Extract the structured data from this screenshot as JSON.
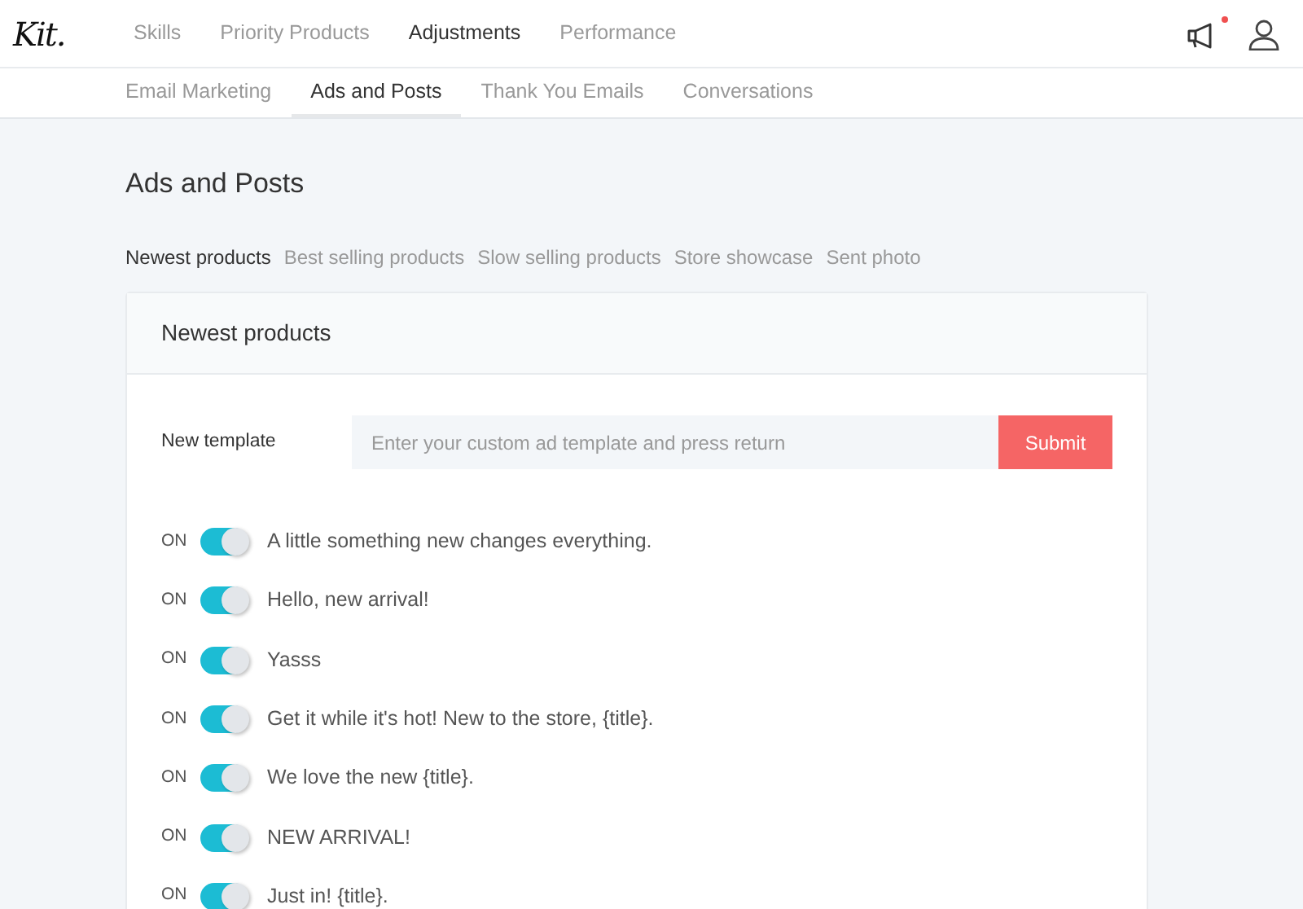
{
  "logo": "Kit.",
  "main_nav": [
    {
      "label": "Skills",
      "selected": false
    },
    {
      "label": "Priority Products",
      "selected": false
    },
    {
      "label": "Adjustments",
      "selected": true
    },
    {
      "label": "Performance",
      "selected": false
    }
  ],
  "notifications": {
    "unread": true
  },
  "sub_nav": [
    {
      "label": "Email Marketing",
      "selected": false
    },
    {
      "label": "Ads and Posts",
      "selected": true
    },
    {
      "label": "Thank You Emails",
      "selected": false
    },
    {
      "label": "Conversations",
      "selected": false
    }
  ],
  "page_title": "Ads and Posts",
  "category_tabs": [
    {
      "label": "Newest products",
      "selected": true
    },
    {
      "label": "Best selling products",
      "selected": false
    },
    {
      "label": "Slow selling products",
      "selected": false
    },
    {
      "label": "Store showcase",
      "selected": false
    },
    {
      "label": "Sent photo",
      "selected": false
    }
  ],
  "card": {
    "title": "Newest products",
    "new_template": {
      "label": "New template",
      "placeholder": "Enter your custom ad template and press return",
      "button": "Submit"
    },
    "templates": [
      {
        "state_label": "ON",
        "on": true,
        "text": "A little something new changes everything."
      },
      {
        "state_label": "ON",
        "on": true,
        "text": "Hello, new arrival!"
      },
      {
        "state_label": "ON",
        "on": true,
        "text": "Yasss"
      },
      {
        "state_label": "ON",
        "on": true,
        "text": "Get it while it's hot! New to the store, {title}."
      },
      {
        "state_label": "ON",
        "on": true,
        "text": "We love the new {title}."
      },
      {
        "state_label": "ON",
        "on": true,
        "text": "NEW ARRIVAL!"
      },
      {
        "state_label": "ON",
        "on": true,
        "text": "Just in! {title}."
      }
    ]
  }
}
